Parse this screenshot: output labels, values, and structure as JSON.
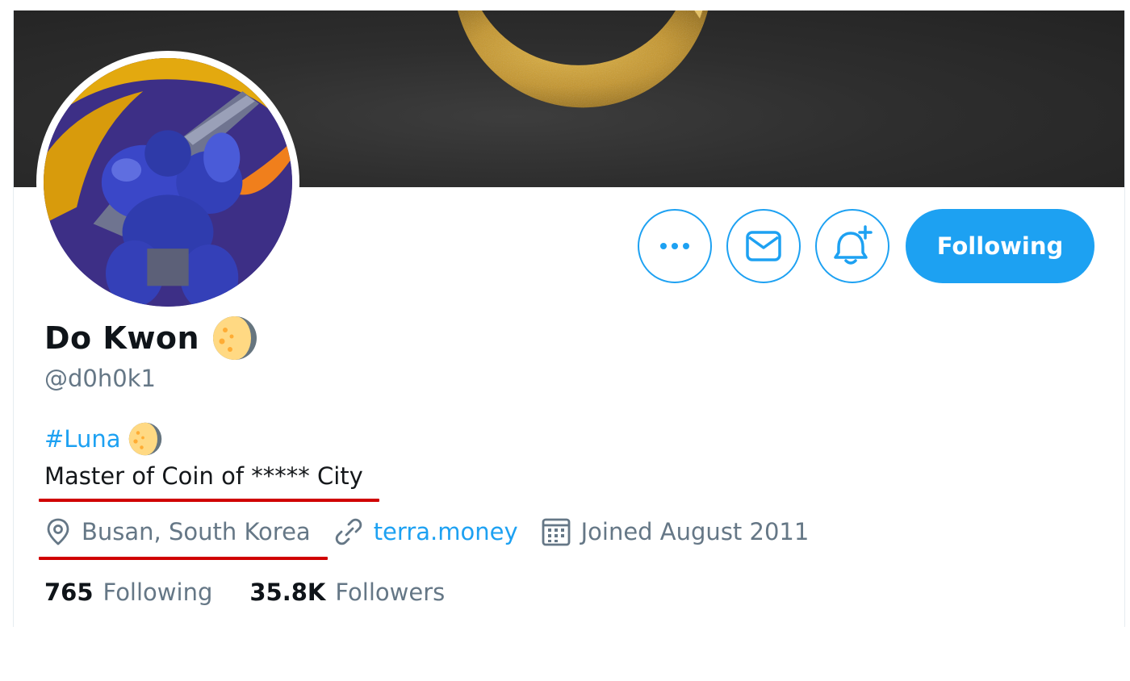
{
  "profile": {
    "display_name": "Do Kwon",
    "handle": "@d0h0k1",
    "name_emoji_icon": "crescent-moon-emoji-icon"
  },
  "actions": {
    "more_icon": "more-dots-icon",
    "message_icon": "envelope-icon",
    "notify_icon": "bell-plus-icon",
    "following_label": "Following"
  },
  "bio": {
    "hashtag": "#Luna",
    "line2": "Master of Coin of ***** City"
  },
  "meta": {
    "location": "Busan, South Korea",
    "website": "terra.money",
    "joined": "Joined August 2011"
  },
  "stats": {
    "following_count": "765",
    "following_label": "Following",
    "followers_count": "35.8K",
    "followers_label": "Followers"
  },
  "colors": {
    "accent": "#1da1f2",
    "secondary_text": "#657786",
    "annotation_underline": "#d00000"
  }
}
